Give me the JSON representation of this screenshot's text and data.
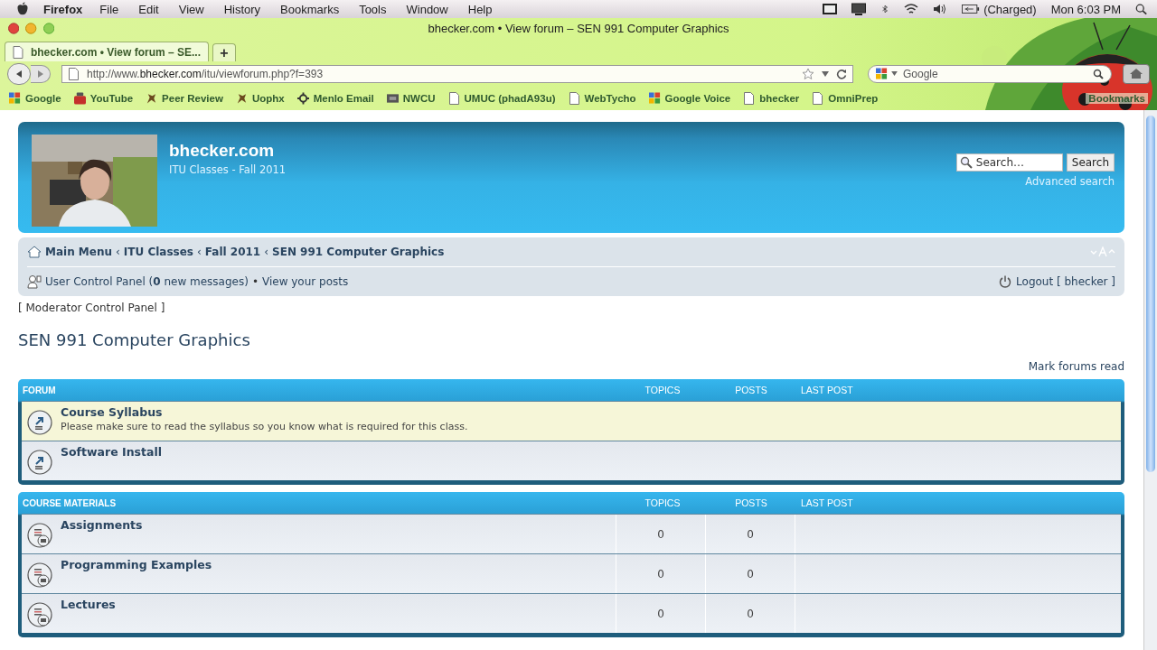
{
  "menubar": {
    "app": "Firefox",
    "menus": [
      "File",
      "Edit",
      "View",
      "History",
      "Bookmarks",
      "Tools",
      "Window",
      "Help"
    ],
    "battery": "(Charged)",
    "clock": "Mon 6:03 PM"
  },
  "window": {
    "title": "bhecker.com • View forum – SEN 991 Computer Graphics"
  },
  "tabs": [
    {
      "label": "bhecker.com • View forum – SE...",
      "selected": true
    }
  ],
  "new_tab": "+",
  "address_bar": {
    "value": "http://www.**bhecker.com**/itu/viewforum.php?f=393"
  },
  "search_bar": {
    "placeholder": "Google"
  },
  "bookmarks": [
    "Google",
    "YouTube",
    "Peer Review",
    "Uophx",
    "Menlo Email",
    "NWCU",
    "UMUC (phadA93u)",
    "WebTycho",
    "Google Voice",
    "bhecker",
    "OmniPrep"
  ],
  "bookmarks_menu": "Bookmarks",
  "site": {
    "title": "bhecker.com",
    "subtitle": "ITU Classes - Fall 2011",
    "search": {
      "placeholder": "Search…",
      "button": "Search"
    },
    "advanced_search": "Advanced search"
  },
  "breadcrumbs": {
    "separator": "‹",
    "items": [
      "Main Menu",
      "ITU Classes",
      "Fall 2011",
      "SEN 991 Computer Graphics"
    ]
  },
  "user_bar": {
    "control_panel": "User Control Panel (**0** new messages)",
    "separator": "•",
    "posts": "View your posts",
    "logout": "Logout [ bhecker ]"
  },
  "moderator_link": "[ Moderator Control Panel ]",
  "page_title": "SEN 991 Computer Graphics",
  "mark_read": "Mark forums read",
  "categories": [
    {
      "title": "FORUM",
      "columns": [
        "TOPICS",
        "POSTS",
        "LAST POST"
      ],
      "forums": [
        {
          "kind": "link",
          "name": "Course Syllabus",
          "description": "Please make sure to read the syllabus so you know what is required for this class.",
          "highlighted": true
        },
        {
          "kind": "link",
          "name": "Software Install",
          "highlighted": false
        }
      ]
    },
    {
      "title": "COURSE MATERIALS",
      "columns": [
        "TOPICS",
        "POSTS",
        "LAST POST"
      ],
      "forums": [
        {
          "kind": "forum",
          "name": "Assignments",
          "topics": "0",
          "posts": "0",
          "highlighted": false
        },
        {
          "kind": "forum",
          "name": "Programming Examples",
          "topics": "0",
          "posts": "0",
          "highlighted": false
        },
        {
          "kind": "forum",
          "name": "Lectures",
          "topics": "0",
          "posts": "0",
          "highlighted": false
        }
      ]
    }
  ]
}
